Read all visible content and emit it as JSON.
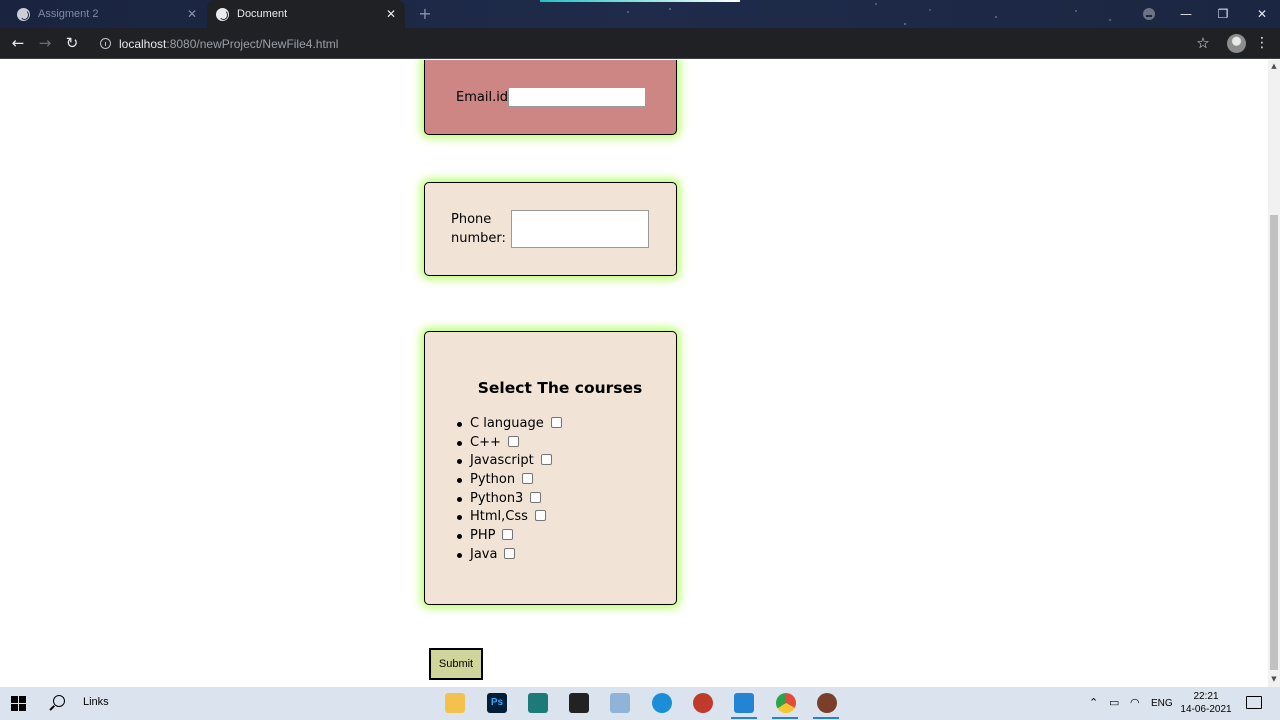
{
  "browser": {
    "tabs": [
      {
        "title": "Assigment 2",
        "active": false
      },
      {
        "title": "Document",
        "active": true
      }
    ],
    "url": {
      "host": "localhost",
      "path": ":8080/newProject/NewFile4.html"
    },
    "window_controls": {
      "minimize": "—",
      "maximize": "❐",
      "close": "✕"
    }
  },
  "form": {
    "email": {
      "label": "Email.id:",
      "value": ""
    },
    "phone": {
      "label_line1": "Phone",
      "label_line2": "number:",
      "value": ""
    },
    "courses": {
      "title": "Select The courses",
      "items": [
        {
          "label": "C language",
          "checked": false
        },
        {
          "label": "C++",
          "checked": false
        },
        {
          "label": "Javascript",
          "checked": false
        },
        {
          "label": "Python",
          "checked": false
        },
        {
          "label": "Python3",
          "checked": false
        },
        {
          "label": "Html,Css",
          "checked": false
        },
        {
          "label": "PHP",
          "checked": false
        },
        {
          "label": "Java",
          "checked": false
        }
      ]
    },
    "submit_label": "Submit"
  },
  "taskbar": {
    "search_label": "Links",
    "tray_language": "ENG",
    "time": "22:21",
    "date": "14-06-2021"
  },
  "colors": {
    "email_card": "#cd8684",
    "card_bg": "#f1e4d6",
    "card_glow": "#b7ff66",
    "submit_bg": "#d0d59a"
  }
}
